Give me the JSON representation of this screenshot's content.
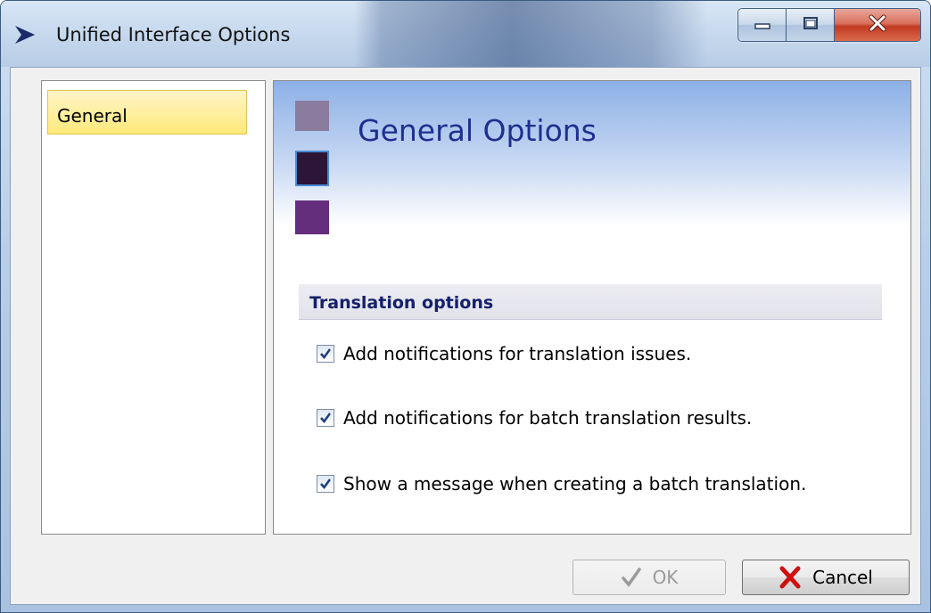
{
  "window": {
    "title": "Unified Interface Options",
    "icon": "arrow-right-icon"
  },
  "window_controls": {
    "minimize_icon": "minimize-icon",
    "maximize_icon": "maximize-icon",
    "close_icon": "close-icon"
  },
  "nav": {
    "items": [
      {
        "label": "General",
        "selected": true
      }
    ]
  },
  "content": {
    "title": "General Options",
    "swatch_colors": [
      "#8a7c9e",
      "#2d1538",
      "#652e7c"
    ],
    "section": {
      "label": "Translation options",
      "options": [
        {
          "label": "Add notifications for translation issues.",
          "checked": true
        },
        {
          "label": "Add notifications for batch translation results.",
          "checked": true
        },
        {
          "label": "Show a message when creating a batch translation.",
          "checked": true
        }
      ]
    }
  },
  "buttons": {
    "ok_label": "OK",
    "ok_enabled": false,
    "ok_icon": "checkmark-icon",
    "cancel_label": "Cancel",
    "cancel_icon": "red-x-icon"
  },
  "colors": {
    "selected_nav_bg": "#ffe97a",
    "title_color": "#1f2f8f",
    "section_label_color": "#15206b"
  }
}
